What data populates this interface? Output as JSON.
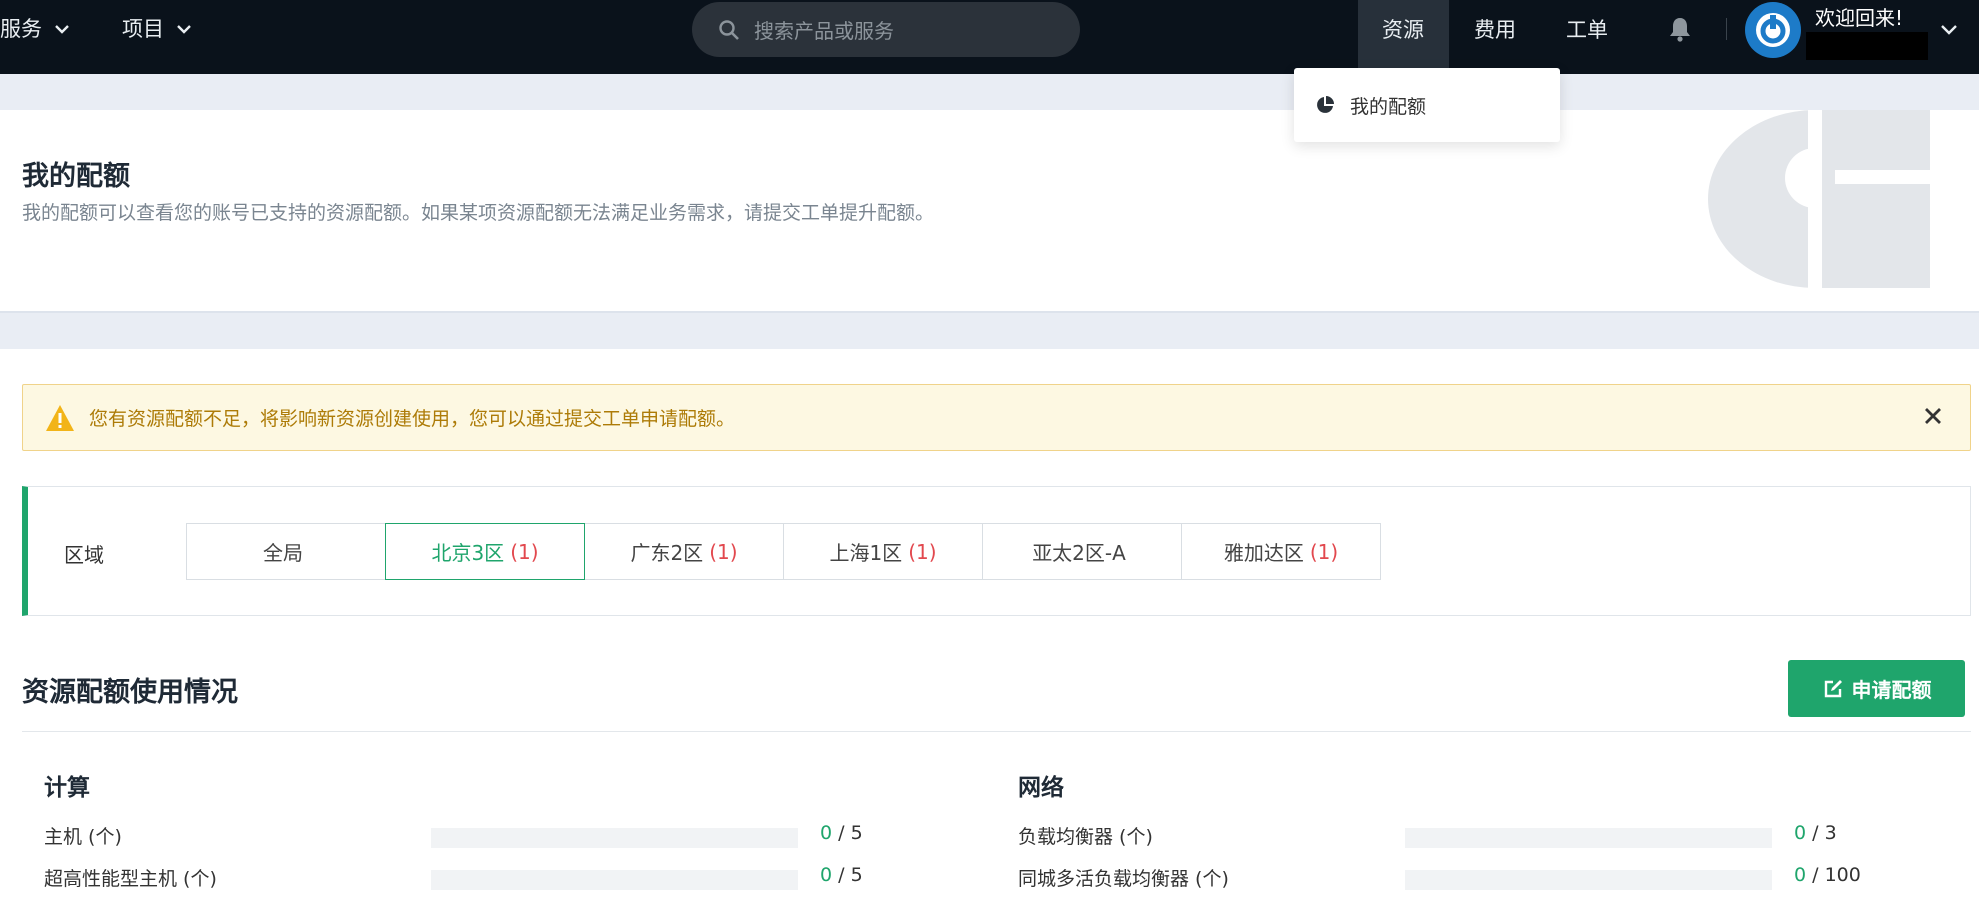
{
  "topnav": {
    "services": "服务",
    "projects": "项目",
    "search_placeholder": "搜索产品或服务",
    "resources": "资源",
    "billing": "费用",
    "tickets": "工单",
    "welcome": "欢迎回来!"
  },
  "dropdown": {
    "my_quota": "我的配额"
  },
  "header": {
    "title": "我的配额",
    "description": "我的配额可以查看您的账号已支持的资源配额。如果某项资源配额无法满足业务需求，请提交工单提升配额。"
  },
  "warning": {
    "text": "您有资源配额不足，将影响新资源创建使用，您可以通过提交工单申请配额。"
  },
  "region": {
    "label": "区域",
    "tabs": [
      {
        "name": "全局",
        "count": ""
      },
      {
        "name": "北京3区",
        "count": "(1)"
      },
      {
        "name": "广东2区",
        "count": "(1)"
      },
      {
        "name": "上海1区",
        "count": "(1)"
      },
      {
        "name": "亚太2区-A",
        "count": ""
      },
      {
        "name": "雅加达区",
        "count": "(1)"
      }
    ],
    "active_index": 1
  },
  "usage": {
    "title": "资源配额使用情况",
    "apply_button": "申请配额",
    "compute": {
      "title": "计算",
      "rows": [
        {
          "label": "主机 (个)",
          "used": "0",
          "total": "/ 5",
          "fraction": 0
        },
        {
          "label": "超高性能型主机 (个)",
          "used": "0",
          "total": "/ 5",
          "fraction": 0
        }
      ]
    },
    "network": {
      "title": "网络",
      "rows": [
        {
          "label": "负载均衡器 (个)",
          "used": "0",
          "total": "/ 3",
          "fraction": 0
        },
        {
          "label": "同城多活负载均衡器 (个)",
          "used": "0",
          "total": "/ 100",
          "fraction": 0
        }
      ]
    }
  },
  "colors": {
    "accent": "#1fa56c",
    "topbar": "#0a121b",
    "warning_text": "#ad7b07",
    "count_red": "#e2484e"
  }
}
